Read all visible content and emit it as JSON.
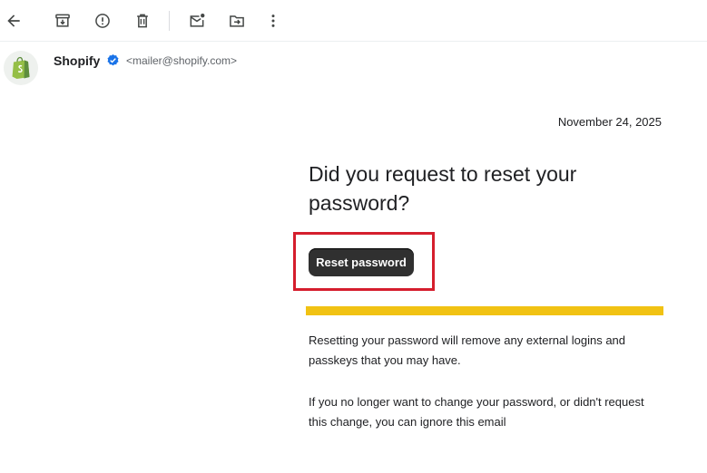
{
  "sender": {
    "name": "Shopify",
    "email": "<mailer@shopify.com>"
  },
  "email": {
    "date": "November 24, 2025",
    "headline": "Did you request to reset your password?",
    "button_label": "Reset password",
    "paragraph1": "Resetting your password will remove any external logins and passkeys that you may have.",
    "paragraph2": "If you no longer want to change your password, or didn't request this change, you can ignore this email"
  },
  "colors": {
    "accent_yellow": "#f1c213",
    "highlight_red": "#d51e2d",
    "button_bg": "#303030",
    "shopify_green": "#95bf47",
    "verified_blue": "#1a73e8"
  },
  "icons": {
    "back": "back-arrow-icon",
    "archive": "archive-icon",
    "report": "report-spam-icon",
    "delete": "delete-icon",
    "mark_unread": "mark-unread-icon",
    "move": "move-to-icon",
    "more": "more-vert-icon"
  }
}
